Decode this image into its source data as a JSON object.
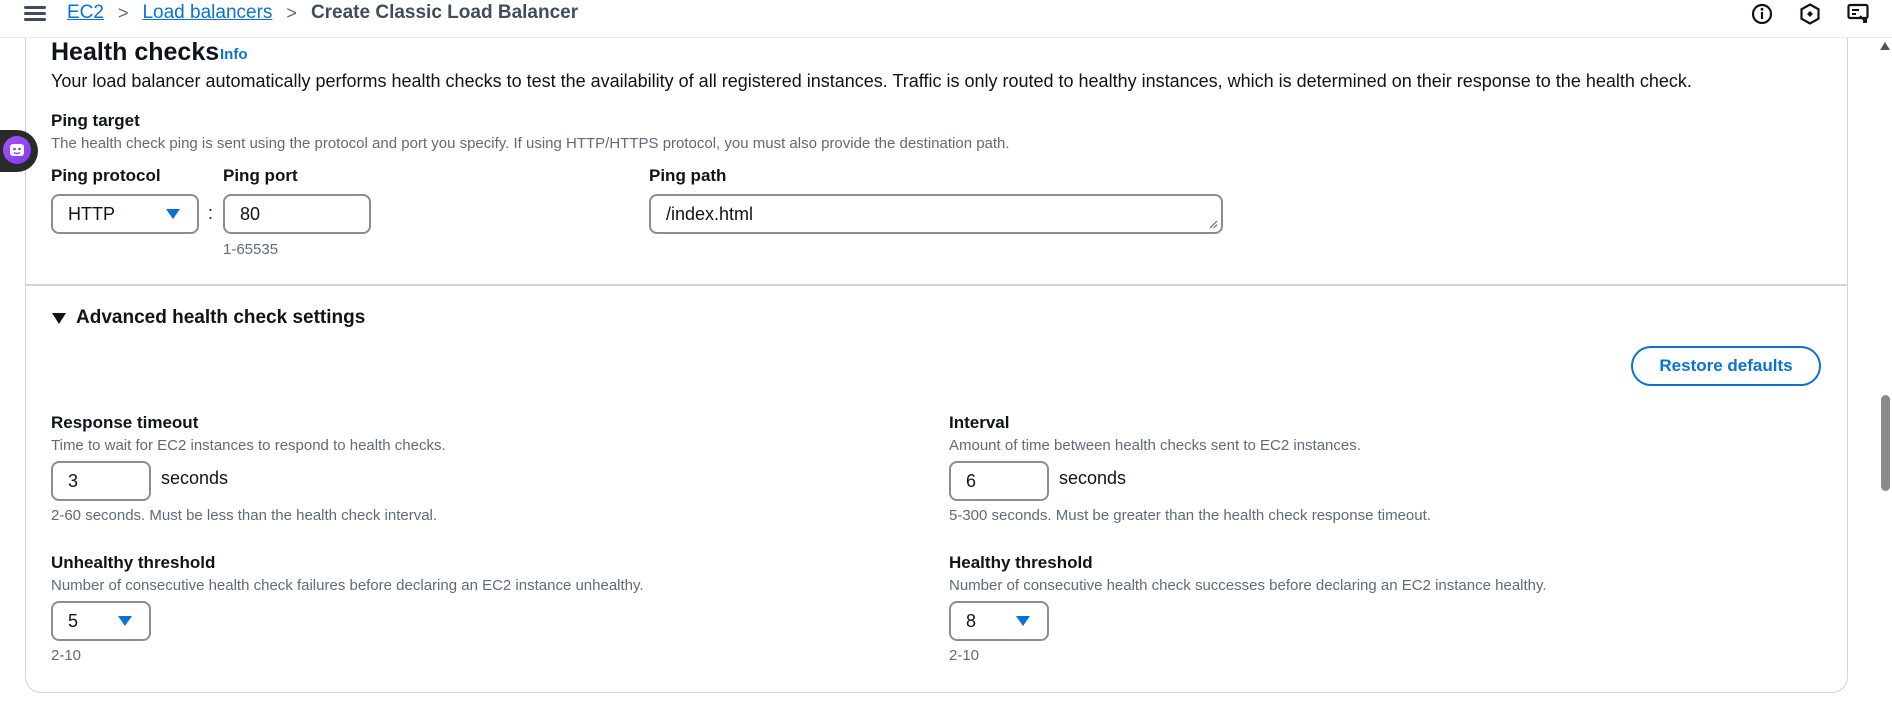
{
  "breadcrumb": {
    "items": [
      "EC2",
      "Load balancers"
    ],
    "current": "Create Classic Load Balancer"
  },
  "icons": {
    "menu": "hamburger-menu-icon",
    "info": "info-circle-icon",
    "notifications": "hexagon-settings-icon",
    "feedback": "screen-feedback-icon",
    "assistant": "assistant-bot-icon"
  },
  "health_checks": {
    "title": "Health checks",
    "info": "Info",
    "description": "Your load balancer automatically performs health checks to test the availability of all registered instances. Traffic is only routed to healthy instances, which is determined on their response to the health check."
  },
  "ping_target": {
    "label": "Ping target",
    "description": "The health check ping is sent using the protocol and port you specify. If using HTTP/HTTPS protocol, you must also provide the destination path.",
    "protocol_label": "Ping protocol",
    "protocol_value": "HTTP",
    "separator": ":",
    "port_label": "Ping port",
    "port_value": "80",
    "port_hint": "1-65535",
    "path_label": "Ping path",
    "path_value": "/index.html"
  },
  "advanced": {
    "label": "Advanced health check settings",
    "restore_label": "Restore defaults",
    "response_timeout": {
      "label": "Response timeout",
      "description": "Time to wait for EC2 instances to respond to health checks.",
      "value": "3",
      "unit": "seconds",
      "hint": "2-60 seconds. Must be less than the health check interval."
    },
    "interval": {
      "label": "Interval",
      "description": "Amount of time between health checks sent to EC2 instances.",
      "value": "6",
      "unit": "seconds",
      "hint": "5-300 seconds. Must be greater than the health check response timeout."
    },
    "unhealthy_threshold": {
      "label": "Unhealthy threshold",
      "description": "Number of consecutive health check failures before declaring an EC2 instance unhealthy.",
      "value": "5",
      "hint": "2-10"
    },
    "healthy_threshold": {
      "label": "Healthy threshold",
      "description": "Number of consecutive health check successes before declaring an EC2 instance healthy.",
      "value": "8",
      "hint": "2-10"
    }
  },
  "colors": {
    "link": "#0972d3",
    "border": "#8c8c94",
    "text": "#0f141a",
    "muted": "#5f6b7a"
  }
}
